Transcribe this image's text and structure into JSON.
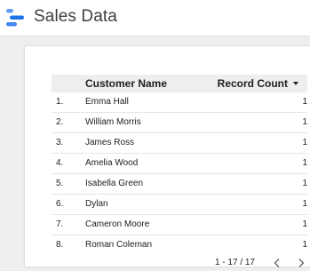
{
  "app": {
    "title": "Sales Data",
    "brand_colors": [
      "#4285f4",
      "#1a73e8",
      "#669df6"
    ]
  },
  "table": {
    "headers": {
      "name": "Customer Name",
      "count": "Record Count"
    },
    "sort": "descending",
    "rows": [
      {
        "idx": "1.",
        "name": "Emma Hall",
        "count": "1"
      },
      {
        "idx": "2.",
        "name": "William Morris",
        "count": "1"
      },
      {
        "idx": "3.",
        "name": "James Ross",
        "count": "1"
      },
      {
        "idx": "4.",
        "name": "Amelia Wood",
        "count": "1"
      },
      {
        "idx": "5.",
        "name": "Isabella Green",
        "count": "1"
      },
      {
        "idx": "6.",
        "name": "Dylan",
        "count": "1"
      },
      {
        "idx": "7.",
        "name": "Cameron Moore",
        "count": "1"
      },
      {
        "idx": "8.",
        "name": "Roman Coleman",
        "count": "1"
      }
    ]
  },
  "pagination": {
    "range": "1 - 17 / 17",
    "prev_icon": "chevron-left-icon",
    "next_icon": "chevron-right-icon"
  }
}
